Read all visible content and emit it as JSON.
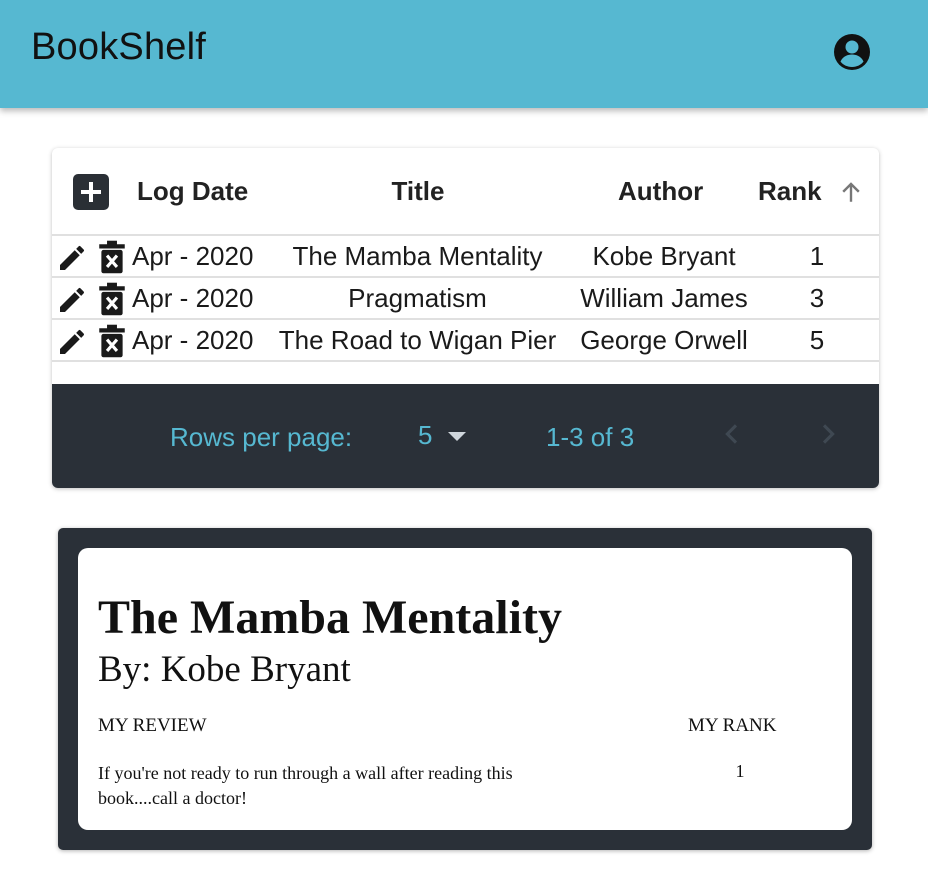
{
  "app": {
    "title": "BookShelf",
    "accent_color": "#56b8d1",
    "account_icon": "account-circle-icon"
  },
  "table": {
    "columns": [
      "Log Date",
      "Title",
      "Author",
      "Rank"
    ],
    "sort": {
      "column": "Rank",
      "direction": "ascending",
      "icon": "arrow-up-icon"
    },
    "rows": [
      {
        "log_date": "Apr - 2020",
        "title": "The Mamba Mentality",
        "author": "Kobe Bryant",
        "rank": "1"
      },
      {
        "log_date": "Apr - 2020",
        "title": "Pragmatism",
        "author": "William James",
        "rank": "3"
      },
      {
        "log_date": "Apr - 2020",
        "title": "The Road to Wigan Pier",
        "author": "George Orwell",
        "rank": "5"
      }
    ],
    "row_icons": [
      "pencil-icon",
      "trash-icon"
    ]
  },
  "pagination": {
    "rows_per_page_label": "Rows per page:",
    "rows_per_page_value": "5",
    "range_text": "1-3 of 3"
  },
  "detail": {
    "title": "The Mamba Mentality",
    "author_line": "By: Kobe Bryant",
    "review_label": "MY REVIEW",
    "rank_label": "MY RANK",
    "review_text": "If you're not ready to run through a wall after reading this book....call a doctor!",
    "rank_value": "1"
  }
}
